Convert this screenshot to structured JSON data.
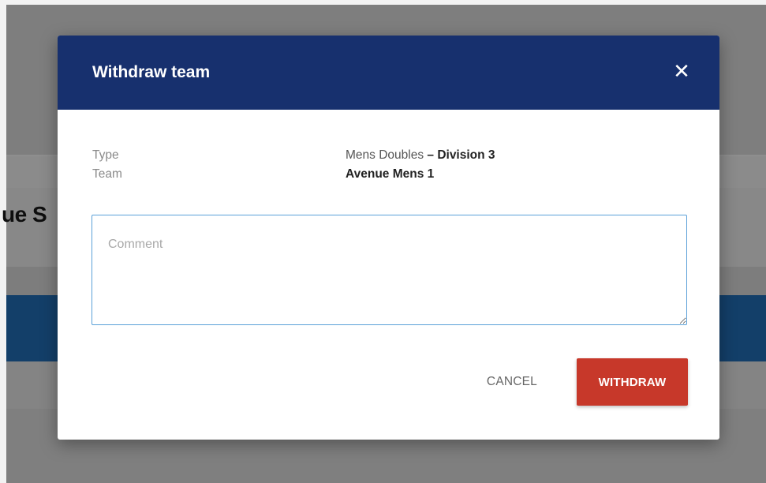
{
  "background": {
    "partial_heading": "ue S"
  },
  "modal": {
    "title": "Withdraw team",
    "close_icon": "close-icon",
    "rows": {
      "type": {
        "label": "Type",
        "value_prefix": "Mens Doubles",
        "value_separator": " – ",
        "value_bold": "Division 3"
      },
      "team": {
        "label": "Team",
        "value": "Avenue Mens 1"
      }
    },
    "comment": {
      "placeholder": "Comment",
      "value": ""
    },
    "actions": {
      "cancel_label": "CANCEL",
      "withdraw_label": "WITHDRAW"
    }
  },
  "colors": {
    "header": "#17306e",
    "withdraw_button": "#c7382a",
    "input_focus_border": "#5aa0d8",
    "overlay": "#8b8b8b"
  }
}
